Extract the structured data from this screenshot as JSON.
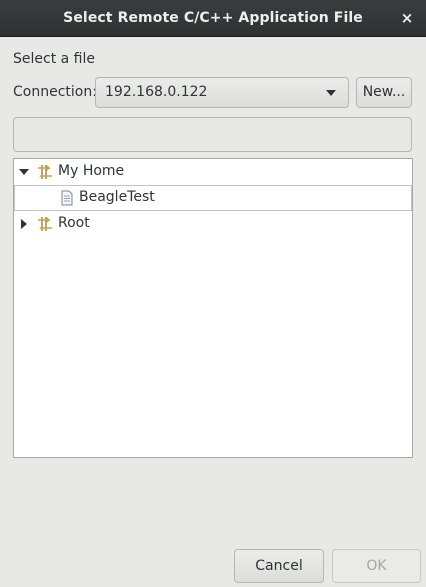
{
  "window": {
    "title": "Select Remote C/C++ Application File",
    "close_glyph": "×"
  },
  "form": {
    "prompt": "Select a file",
    "connection_label": "Connection:",
    "connection_value": "192.168.0.122",
    "new_button": "New...",
    "path_value": ""
  },
  "tree": {
    "items": [
      {
        "label": "My Home",
        "icon": "remote-folder-icon",
        "expanded": true,
        "depth": 0
      },
      {
        "label": "BeagleTest",
        "icon": "file-icon",
        "selected": true,
        "depth": 1
      },
      {
        "label": "Root",
        "icon": "remote-folder-icon",
        "expanded": false,
        "depth": 0
      }
    ]
  },
  "buttons": {
    "cancel": "Cancel",
    "ok": "OK",
    "ok_enabled": false
  }
}
